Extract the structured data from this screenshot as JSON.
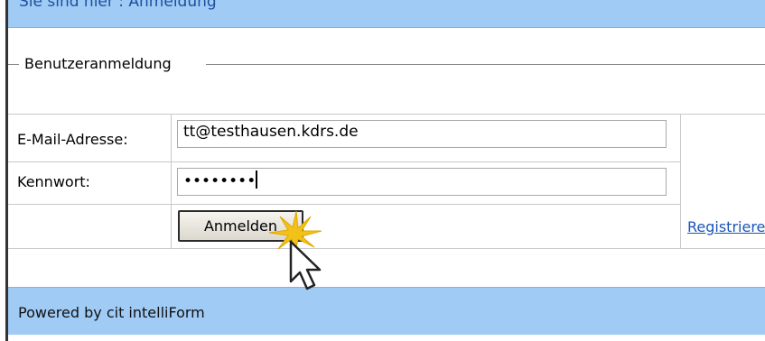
{
  "breadcrumb": {
    "text": "Sie sind hier : Anmeldung"
  },
  "login_section": {
    "legend": "Benutzeranmeldung"
  },
  "form": {
    "email_label": "E-Mail-Adresse:",
    "email_value": "tt@testhausen.kdrs.de",
    "password_label": "Kennwort:",
    "password_mask": "••••••••",
    "submit_label": "Anmelden",
    "register_link": "Registrieren"
  },
  "footer": {
    "text": "Powered by cit intelliForm"
  },
  "colors": {
    "bar": "#9fcbf5",
    "link": "#1a56b8",
    "breadcrumb_text": "#1f4e9c"
  },
  "icons": {
    "cursor": "mouse-pointer-icon",
    "click": "click-burst-icon"
  }
}
